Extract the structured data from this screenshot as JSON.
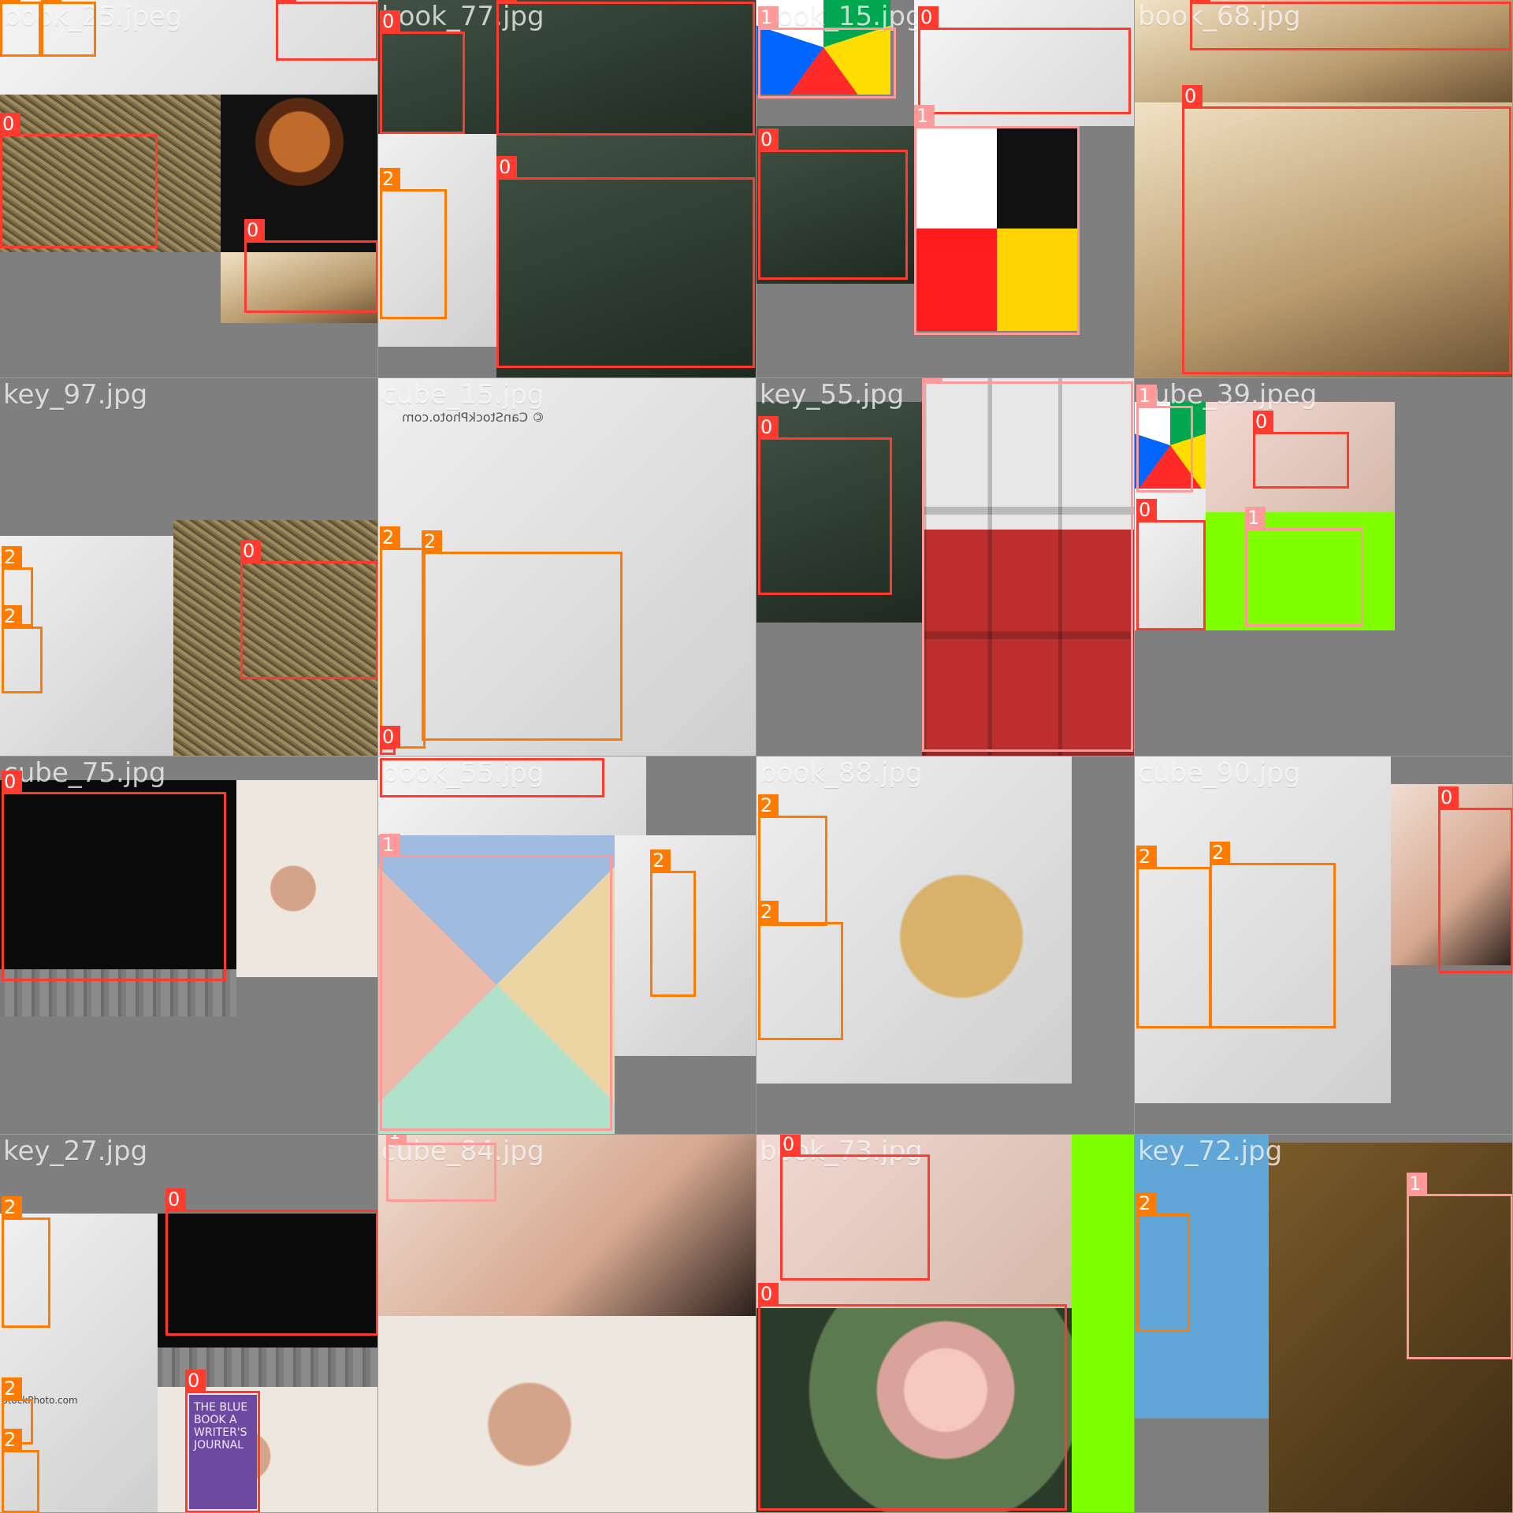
{
  "mosaic": {
    "tiles": [
      {
        "filename": "book_25.jpeg",
        "detections": [
          {
            "label": "2"
          },
          {
            "label": "2"
          },
          {
            "label": "0"
          },
          {
            "label": "0"
          },
          {
            "label": "0"
          }
        ]
      },
      {
        "filename": "book_77.jpg",
        "detections": [
          {
            "label": "0"
          },
          {
            "label": "0"
          },
          {
            "label": "2"
          },
          {
            "label": "0"
          }
        ]
      },
      {
        "filename": "book_15.jpg",
        "detections": [
          {
            "label": "1"
          },
          {
            "label": "0"
          },
          {
            "label": "1"
          },
          {
            "label": "0"
          }
        ]
      },
      {
        "filename": "book_68.jpg",
        "detections": [
          {
            "label": "0"
          },
          {
            "label": "0"
          }
        ]
      },
      {
        "filename": "key_97.jpg",
        "detections": [
          {
            "label": "2"
          },
          {
            "label": "2"
          },
          {
            "label": "0"
          }
        ]
      },
      {
        "filename": "cube_15.jpg",
        "watermark": "© CanStockPhoto.com",
        "detections": [
          {
            "label": "2"
          },
          {
            "label": "2"
          },
          {
            "label": "0"
          }
        ]
      },
      {
        "filename": "key_55.jpg",
        "detections": [
          {
            "label": "0"
          },
          {
            "label": "1"
          }
        ]
      },
      {
        "filename": "cube_39.jpeg",
        "detections": [
          {
            "label": "1"
          },
          {
            "label": "0"
          },
          {
            "label": "0"
          },
          {
            "label": "1"
          }
        ]
      },
      {
        "filename": "cube_75.jpg",
        "detections": [
          {
            "label": "0"
          }
        ]
      },
      {
        "filename": "book_55.jpg",
        "detections": [
          {
            "label": "1"
          },
          {
            "label": "2"
          }
        ]
      },
      {
        "filename": "book_88.jpg",
        "detections": [
          {
            "label": "2"
          },
          {
            "label": "2"
          }
        ]
      },
      {
        "filename": "cube_90.jpg",
        "detections": [
          {
            "label": "2"
          },
          {
            "label": "2"
          },
          {
            "label": "0"
          }
        ]
      },
      {
        "filename": "key_27.jpg",
        "watermark": "StockPhoto.com",
        "detections": [
          {
            "label": "2"
          },
          {
            "label": "0"
          },
          {
            "label": "2"
          },
          {
            "label": "2"
          },
          {
            "label": "0"
          }
        ]
      },
      {
        "filename": "cube_84.jpg",
        "detections": [
          {
            "label": "1"
          }
        ]
      },
      {
        "filename": "book_73.jpg",
        "detections": [
          {
            "label": "0"
          },
          {
            "label": "0"
          }
        ]
      },
      {
        "filename": "key_72.jpg",
        "detections": [
          {
            "label": "2"
          },
          {
            "label": "1"
          }
        ]
      }
    ],
    "book_cover_text": "THE BLUE BOOK A WRITER'S JOURNAL",
    "label_colors": {
      "0": "#ff3b30",
      "1": "#ff9a9a",
      "2": "#ff7a00"
    }
  }
}
